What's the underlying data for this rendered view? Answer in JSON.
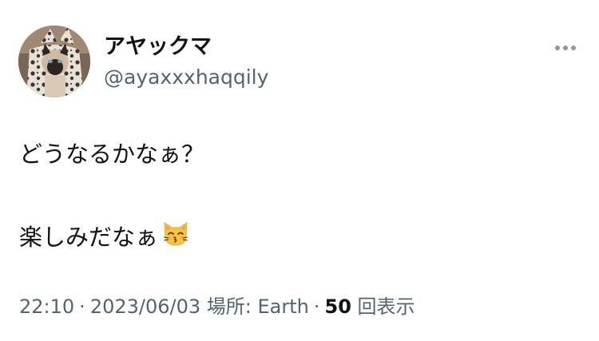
{
  "author": {
    "display_name": "アヤックマ",
    "handle": "@ayaxxxhaqqily"
  },
  "tweet": {
    "line1": "どうなるかなぁ？",
    "line2": "楽しみだなぁ",
    "line2_emoji": "kissing-cat-face-icon"
  },
  "meta": {
    "time": "22:10",
    "separator": "·",
    "date": "2023/06/03",
    "location": "場所: Earth",
    "views_count": "50",
    "views_label": "回表示"
  },
  "icons": {
    "more": "more-horizontal-icon",
    "avatar": "avatar-siamese-cat"
  },
  "colors": {
    "text_primary": "#0f1419",
    "text_secondary": "#536471",
    "icon_gray": "#8b98a5"
  }
}
